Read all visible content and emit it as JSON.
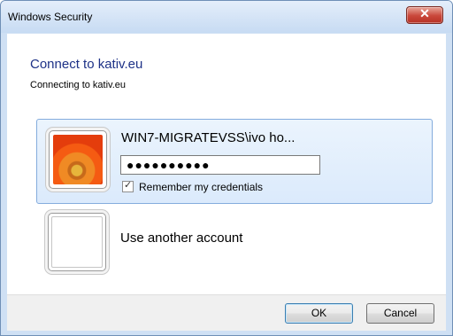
{
  "window": {
    "title": "Windows Security",
    "close_glyph": "✕"
  },
  "dialog": {
    "heading": "Connect to kativ.eu",
    "subheading": "Connecting to kativ.eu"
  },
  "credential": {
    "account_name": "WIN7-MIGRATEVSS\\ivo ho...",
    "password_masked": "●●●●●●●●●●",
    "remember_label": "Remember my credentials",
    "remember_checked": true,
    "check_glyph": "✓"
  },
  "other_account": {
    "label": "Use another account"
  },
  "buttons": {
    "ok": "OK",
    "cancel": "Cancel"
  },
  "icons": {
    "user_tile": "user-tile-flower-icon",
    "blank_tile": "blank-user-tile-icon"
  }
}
